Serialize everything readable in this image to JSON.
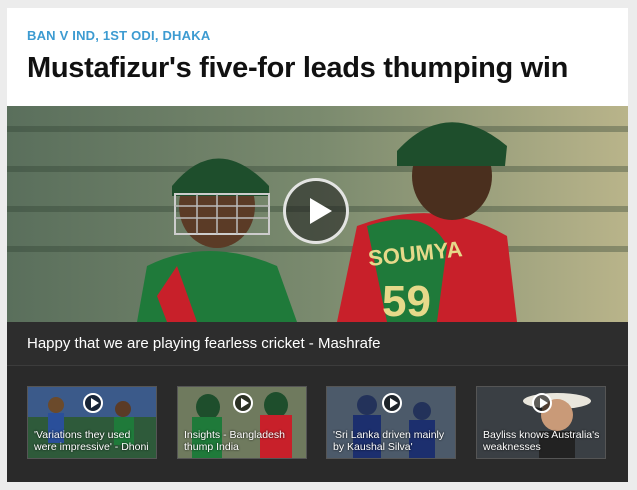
{
  "kicker": "BAN V IND, 1ST ODI, DHAKA",
  "headline": "Mustafizur's five-for leads thumping win",
  "hero": {
    "caption": "Happy that we are playing fearless cricket - Mashrafe",
    "jersey_name": "SOUMYA",
    "jersey_number": "59"
  },
  "videos": [
    {
      "label": "'Variations they used were impressive' - Dhoni"
    },
    {
      "label": "Insights - Bangladesh thump India"
    },
    {
      "label": "'Sri Lanka driven mainly by Kaushal Silva'"
    },
    {
      "label": "Bayliss knows Australia's weaknesses"
    }
  ],
  "colors": {
    "kicker": "#3d9bd1",
    "jersey_green": "#1f7a3a",
    "jersey_red": "#c8202a"
  }
}
